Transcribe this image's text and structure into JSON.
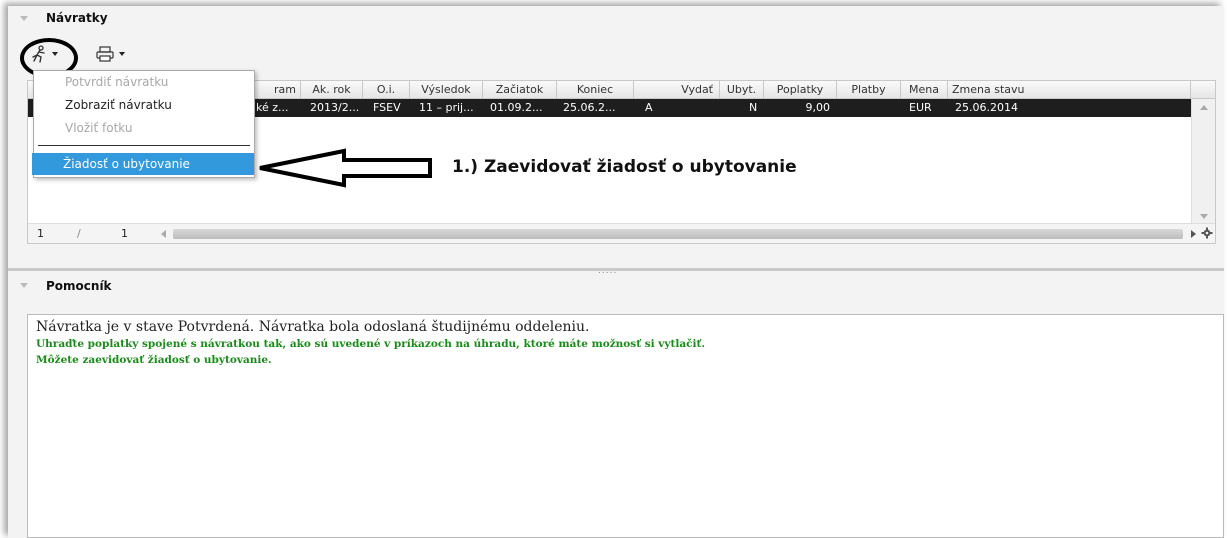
{
  "top_panel": {
    "title": "Návratky"
  },
  "toolbar": {
    "action_icon": "runner-icon",
    "print_icon": "printer-icon"
  },
  "table": {
    "columns": [
      "Študijný program",
      "Ak. rok",
      "O.i.",
      "Výsledok",
      "Začiatok",
      "Koniec",
      "Vydať",
      "Ubyt.",
      "Poplatky",
      "Platby",
      "Mena",
      "Zmena stavu"
    ],
    "visible_column_labels": [
      "ram",
      "Ak. rok",
      "O.i.",
      "Výsledok",
      "Začiatok",
      "Koniec",
      "Vydať",
      "Ubyt.",
      "Poplatky",
      "Platby",
      "Mena",
      "Zmena stavu"
    ],
    "row": [
      "ké z...",
      "2013/2...",
      "FSEV",
      "11 – prij...",
      "01.09.2...",
      "25.06.2...",
      "A",
      "N",
      "9,00",
      "",
      "EUR",
      "25.06.2014"
    ],
    "pager": {
      "page": "1",
      "sep": "/",
      "total": "1"
    }
  },
  "context_menu": {
    "items": [
      {
        "label": "Potvrdiť návratku",
        "enabled": false
      },
      {
        "label": "Zobraziť návratku",
        "enabled": true
      },
      {
        "label": "Vložiť fotku",
        "enabled": false
      },
      {
        "label": "Žiadosť o ubytovanie",
        "enabled": true,
        "highlighted": true
      }
    ]
  },
  "annotation": {
    "text": "1.) Zaevidovať žiadosť o ubytovanie"
  },
  "helper_panel": {
    "title": "Pomocník",
    "line1": "Návratka je v stave Potvrdená. Návratka bola odoslaná študijnému oddeleniu.",
    "line2": "Uhraďte poplatky spojené s návratkou tak, ako sú uvedené v príkazoch na úhradu, ktoré máte možnosť si vytlačiť.",
    "line3": "Môžete zaevidovať žiadosť o ubytovanie."
  },
  "colors": {
    "menu_highlight": "#3399dd",
    "helper_green": "#1a8a1a",
    "selected_row": "#1e1e1e"
  }
}
